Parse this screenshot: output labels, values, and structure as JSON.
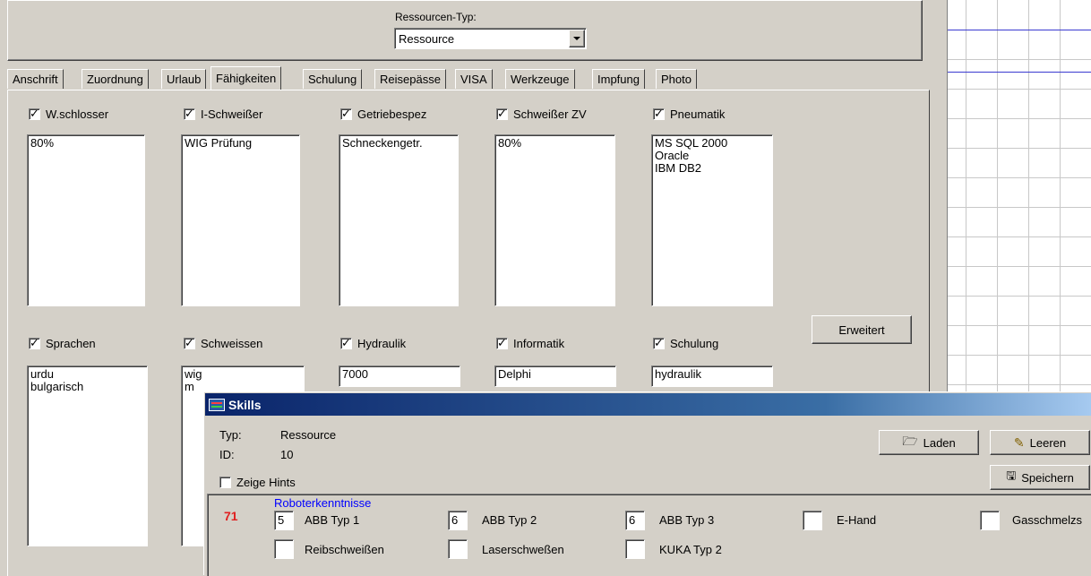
{
  "header": {
    "resource_type_label": "Ressourcen-Typ:",
    "resource_type_value": "Ressource"
  },
  "tabs": [
    {
      "label": "Anschrift",
      "active": false
    },
    {
      "label": "Zuordnung",
      "active": false
    },
    {
      "label": "Urlaub",
      "active": false
    },
    {
      "label": "Fähigkeiten",
      "active": true
    },
    {
      "label": "Schulung",
      "active": false
    },
    {
      "label": "Reisepässe",
      "active": false
    },
    {
      "label": "VISA",
      "active": false
    },
    {
      "label": "Werkzeuge",
      "active": false
    },
    {
      "label": "Impfung",
      "active": false
    },
    {
      "label": "Photo",
      "active": false
    }
  ],
  "skills_row1": [
    {
      "label": "W.schlosser",
      "checked": true,
      "memo": "80%"
    },
    {
      "label": "I-Schweißer",
      "checked": true,
      "memo": "WIG Prüfung"
    },
    {
      "label": "Getriebespez",
      "checked": true,
      "memo": "Schneckengetr."
    },
    {
      "label": "Schweißer ZV",
      "checked": true,
      "memo": "80%"
    },
    {
      "label": "Pneumatik",
      "checked": true,
      "memo": "MS SQL 2000\nOracle\nIBM DB2"
    }
  ],
  "skills_row2": [
    {
      "label": "Sprachen",
      "checked": true,
      "memo": "urdu\nbulgarisch"
    },
    {
      "label": "Schweissen",
      "checked": true,
      "memo": "wig\nm"
    },
    {
      "label": "Hydraulik",
      "checked": true,
      "memo": "7000"
    },
    {
      "label": "Informatik",
      "checked": true,
      "memo": "Delphi"
    },
    {
      "label": "Schulung",
      "checked": true,
      "memo": "hydraulik"
    }
  ],
  "extended_button": "Erweitert",
  "skills_window": {
    "title": "Skills",
    "typ_label": "Typ:",
    "typ_value": "Ressource",
    "id_label": "ID:",
    "id_value": "10",
    "show_hints_label": "Zeige Hints",
    "show_hints_checked": false,
    "load_button": "Laden",
    "clear_button": "Leeren",
    "save_button": "Speichern",
    "group_number": "71",
    "group_title": "Roboterkenntnisse",
    "items_row1": [
      {
        "value": "5",
        "label": "ABB Typ 1"
      },
      {
        "value": "6",
        "label": "ABB Typ 2"
      },
      {
        "value": "6",
        "label": "ABB Typ 3"
      },
      {
        "value": "",
        "label": "E-Hand"
      },
      {
        "value": "",
        "label": "Gasschmelzs"
      }
    ],
    "items_row2": [
      {
        "value": "",
        "label": "Reibschweißen"
      },
      {
        "value": "",
        "label": "Laserschweßen"
      },
      {
        "value": "",
        "label": "KUKA Typ 2"
      }
    ]
  },
  "colors": {
    "face": "#d4d0c8",
    "title_gradient_start": "#0a246a",
    "title_gradient_end": "#a6caf0",
    "group_title": "#0000ff",
    "group_number": "#e02020",
    "grid_blue": "#3a3ad0"
  }
}
